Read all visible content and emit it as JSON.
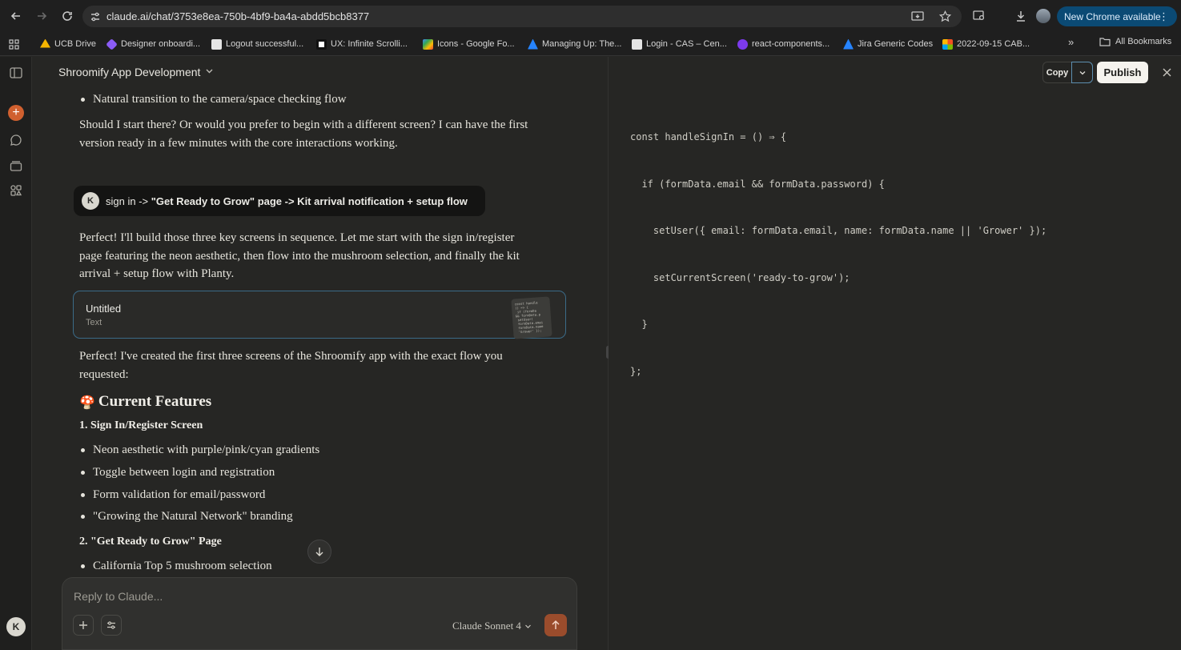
{
  "browser": {
    "url": "claude.ai/chat/3753e8ea-750b-4bf9-ba4a-abdd5bcb8377",
    "update_label": "New Chrome available",
    "bookmarks": [
      {
        "label": "UCB Drive",
        "color": "#f4b400"
      },
      {
        "label": "Designer onboardi...",
        "color": "#8b5cf6"
      },
      {
        "label": "Logout successful...",
        "color": "#e5e5e5"
      },
      {
        "label": "UX: Infinite Scrolli...",
        "color": "#111111"
      },
      {
        "label": "Icons - Google Fo...",
        "color": "#4285f4"
      },
      {
        "label": "Managing Up: The...",
        "color": "#2684ff"
      },
      {
        "label": "Login - CAS – Cen...",
        "color": "#e5e5e5"
      },
      {
        "label": "react-components...",
        "color": "#7c3aed"
      },
      {
        "label": "Jira Generic Codes",
        "color": "#2684ff"
      },
      {
        "label": "2022-09-15 CAB...",
        "color": "#f25022"
      }
    ],
    "more_label": "»",
    "all_bookmarks": "All Bookmarks"
  },
  "sidebar": {
    "avatar_initial": "K"
  },
  "chat": {
    "title": "Shroomify App Development",
    "bullet_top": "Natural transition to the camera/space checking flow",
    "para1_line1": "Should I start there? Or would you prefer to begin with a different screen? I can have the first",
    "para1_line2": "version ready in a few minutes with the core interactions working.",
    "user_initial": "K",
    "user_msg_plain": "sign in -> ",
    "user_msg_bold": "\"Get Ready to Grow\" page -> Kit arrival notification + setup flow",
    "para2_line1": "Perfect! I'll build those three key screens in sequence. Let me start with the sign in/register",
    "para2_line2": "page featuring the neon aesthetic, then flow into the mushroom selection, and finally the kit",
    "para2_line3": "arrival + setup flow with Planty.",
    "artifact_title": "Untitled",
    "artifact_type": "Text",
    "artifact_thumb": "const handle\n() => {\n if (formDa\n&& formData.p\n setUser(\n formData.emai\n formData.name\n 'Grower' });",
    "para3_line1": "Perfect! I've created the first three screens of the Shroomify app with the exact flow you",
    "para3_line2": "requested:",
    "features_heading": "Current Features",
    "features_emoji": "🍄",
    "section1_heading": "1. Sign In/Register Screen",
    "section1_items": [
      "Neon aesthetic with purple/pink/cyan gradients",
      "Toggle between login and registration",
      "Form validation for email/password",
      "\"Growing the Natural Network\" branding"
    ],
    "section2_heading": "2. \"Get Ready to Grow\" Page",
    "section2_items": [
      "California Top 5 mushroom selection"
    ]
  },
  "composer": {
    "placeholder": "Reply to Claude...",
    "model": "Claude Sonnet 4"
  },
  "artifact_panel": {
    "copy_label": "Copy",
    "publish_label": "Publish",
    "code_lines": [
      "const handleSignIn = () ⇒ {",
      "  if (formData.email && formData.password) {",
      "    setUser({ email: formData.email, name: formData.name || 'Grower' });",
      "    setCurrentScreen('ready-to-grow');",
      "  }",
      "};"
    ]
  }
}
